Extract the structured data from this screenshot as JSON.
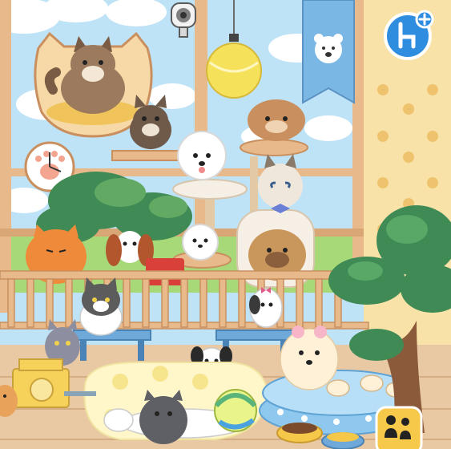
{
  "scene": {
    "name": "pet-cafe-room",
    "colors": {
      "sky": "#bfe3f6",
      "cloud": "#ffffff",
      "wood_frame": "#e8b98a",
      "wood_dark": "#c98f5e",
      "wallpaper": "#f8e2a8",
      "wallpaper_paw": "#efc36e",
      "floor": "#e9c8a4",
      "rug": "#fff6c9",
      "rug_spots": "#f7e58e",
      "grass": "#9ad56a",
      "tree_leaf": "#3f8a55",
      "tree_trunk": "#8a5a3a",
      "banner_blue": "#7bb7e4",
      "tennis_ball": "#f5e25a",
      "pool_blue": "#8ec8ee",
      "table_blue": "#6ea9d9",
      "fence": "#e7b98b",
      "hud_blue": "#2f8de0"
    }
  },
  "hud": {
    "furniture_button_icon": "chair-plus-icon",
    "characters_button_icon": "people-icon"
  }
}
